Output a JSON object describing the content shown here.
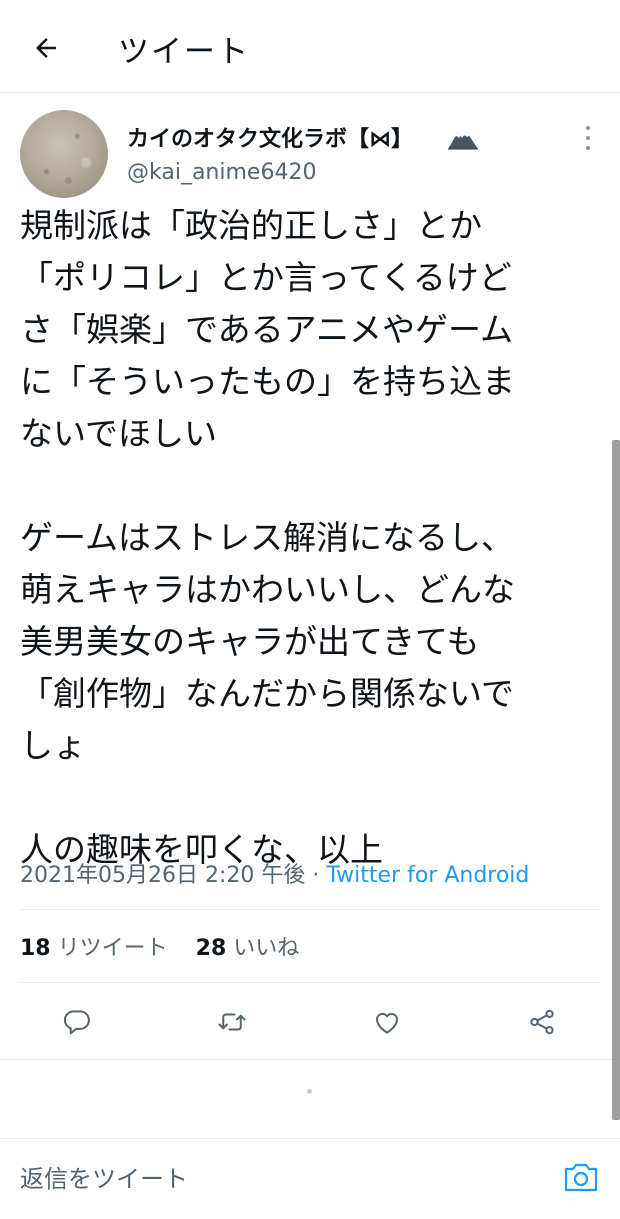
{
  "header": {
    "back_icon": "arrow-left-icon",
    "title": "ツイート"
  },
  "tweet": {
    "author": {
      "display_name": "カイのオタク文化ラボ【⋈】",
      "name_emoji_icon": "snow-mountain-icon",
      "username": "@kai_anime6420"
    },
    "more_icon": "more-vertical-icon",
    "text_lines": [
      "規制派は「政治的正しさ」とか",
      "「ポリコレ」とか言ってくるけど",
      "さ「娯楽」であるアニメやゲーム",
      "に「そういったもの」を持ち込ま",
      "ないでほしい",
      "ゲームはストレス解消になるし、",
      "萌えキャラはかわいいし、どんな",
      "美男美女のキャラが出てきても",
      "「創作物」なんだから関係ないで",
      "しょ",
      "人の趣味を叩くな、以上"
    ],
    "timestamp": "2021年05月26日 2:20 午後",
    "separator": " · ",
    "source": "Twitter for Android",
    "stats": {
      "retweets_count": "18",
      "retweets_label": "リツイート",
      "likes_count": "28",
      "likes_label": "いいね"
    },
    "actions": {
      "reply_icon": "reply-icon",
      "retweet_icon": "retweet-icon",
      "like_icon": "heart-icon",
      "share_icon": "share-icon"
    }
  },
  "reply": {
    "placeholder": "返信をツイート",
    "camera_icon": "camera-icon"
  },
  "colors": {
    "accent": "#1d9bf0",
    "text_primary": "#0f1419",
    "text_secondary": "#536471",
    "divider": "#e6ecf0"
  }
}
